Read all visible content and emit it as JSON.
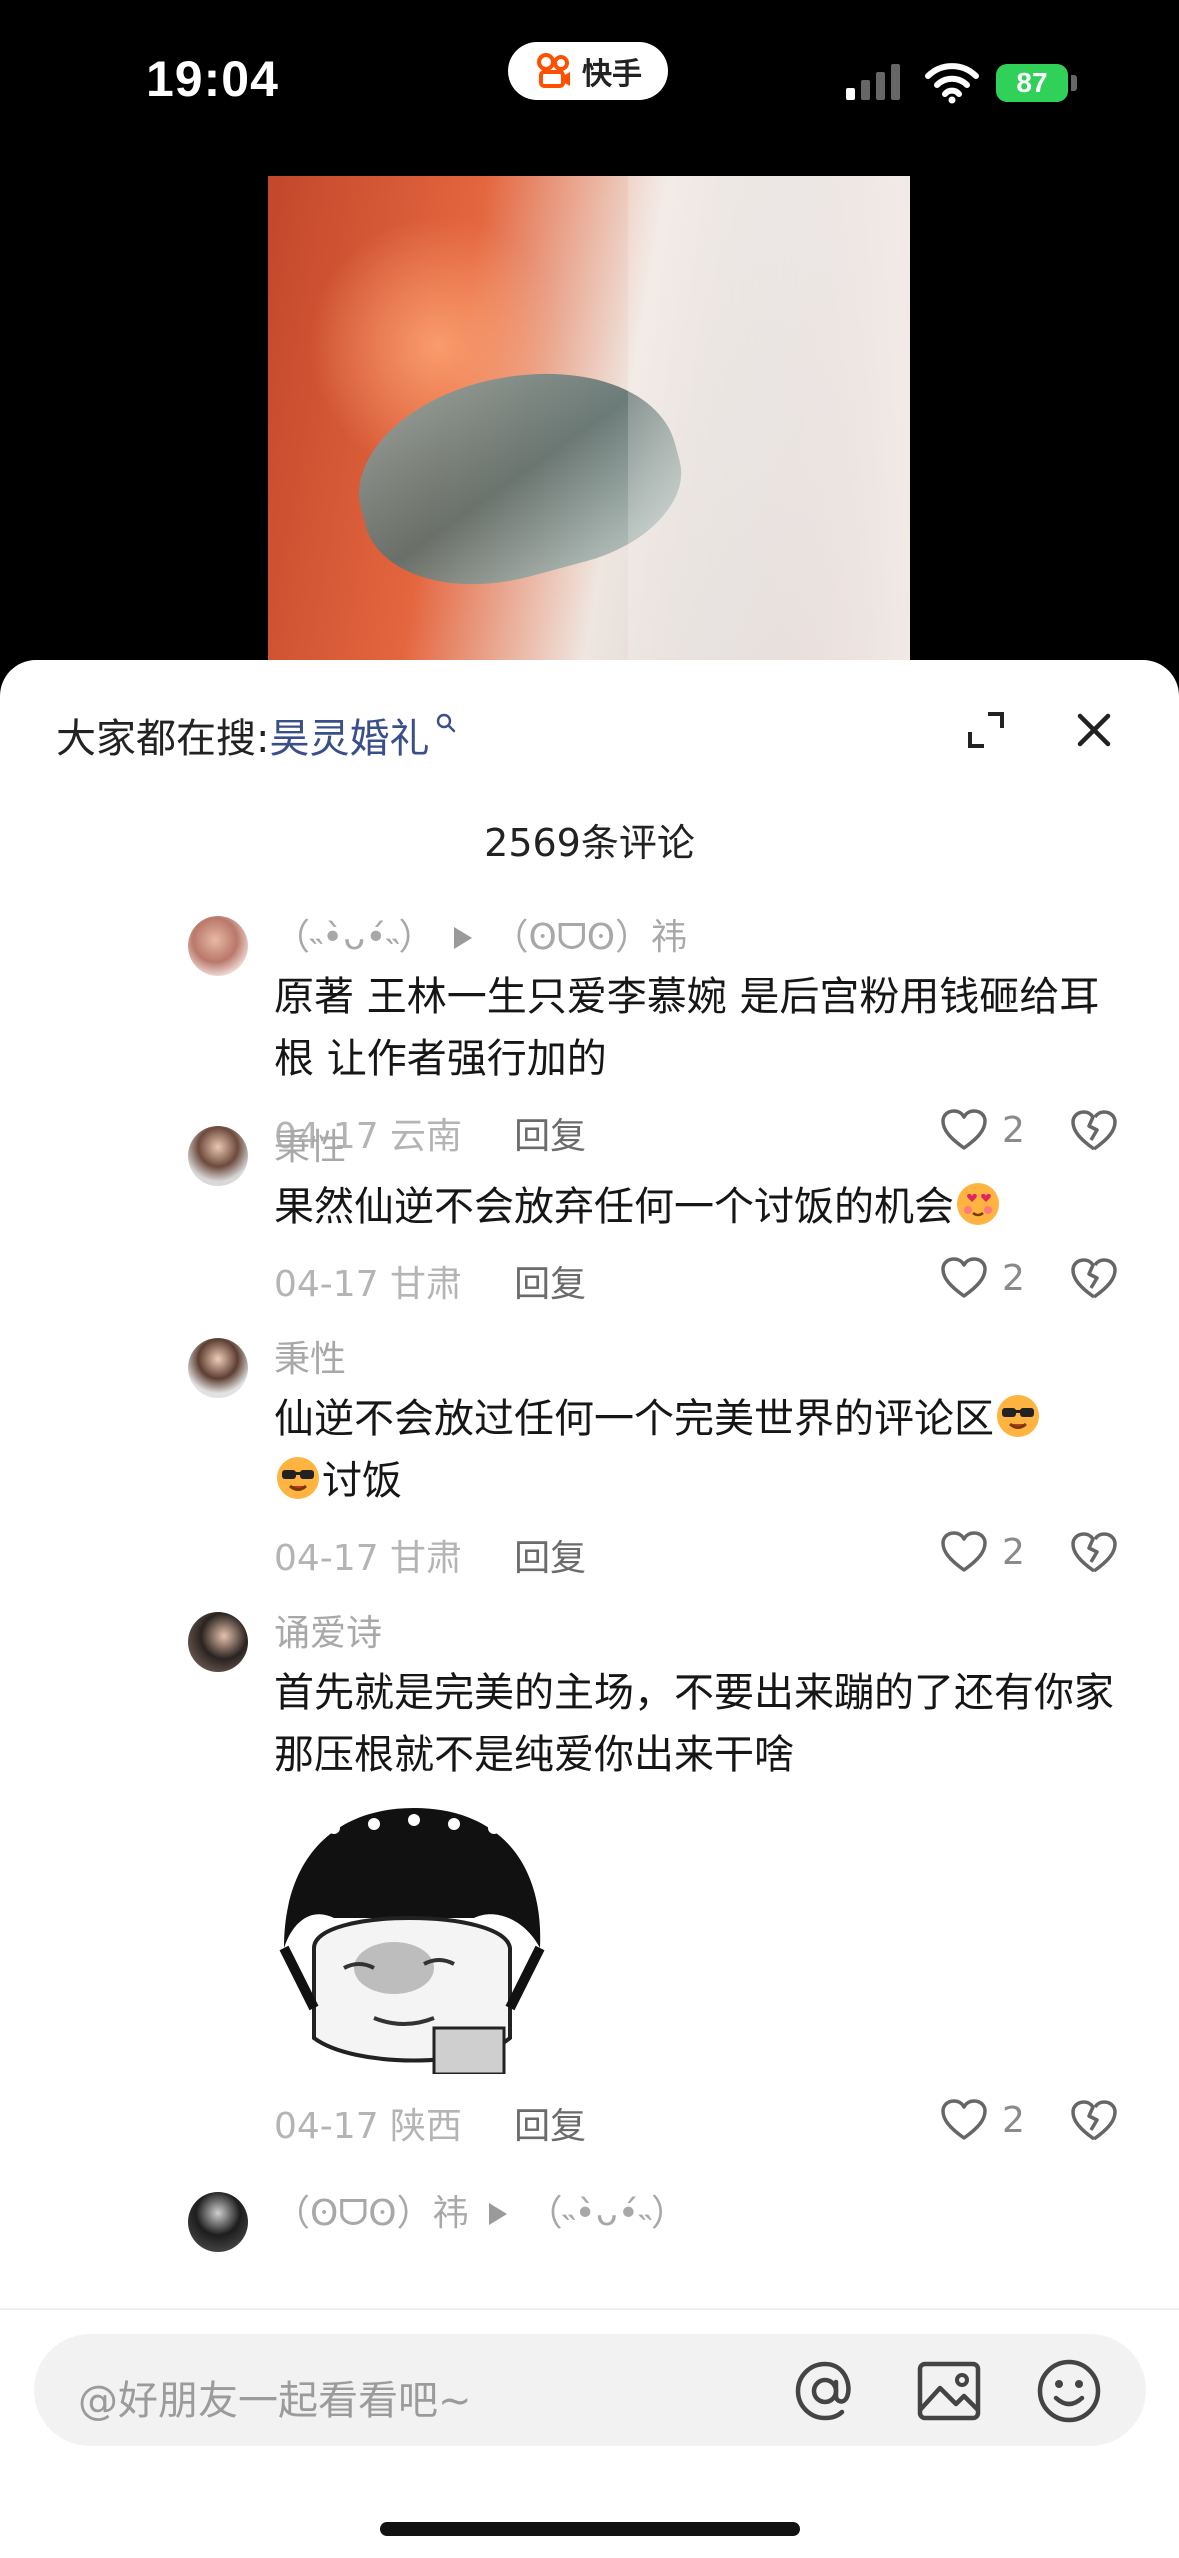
{
  "status_bar": {
    "time": "19:04",
    "app_name": "快手",
    "battery": "87"
  },
  "sheet": {
    "search_prefix": "大家都在搜:",
    "search_term": "昊灵婚礼",
    "comment_count": "2569条评论"
  },
  "comments": [
    {
      "user": "（˵•̀ᴗ•́˵）",
      "reply_to": "（ʘᗜʘ）祎",
      "text": "原著 王林一生只爱李慕婉 是后宫粉用钱砸给耳根 让作者强行加的",
      "date": "04-17 云南",
      "reply_label": "回复",
      "likes": "2"
    },
    {
      "user": "秉性",
      "text": "果然仙逆不会放弃任何一个讨饭的机会",
      "date": "04-17 甘肃",
      "reply_label": "回复",
      "likes": "2",
      "emoji": "heart-eyes-face"
    },
    {
      "user": "秉性",
      "text_a": "仙逆不会放过任何一个完美世界的评论区",
      "text_b": "讨饭",
      "date": "04-17 甘肃",
      "reply_label": "回复",
      "likes": "2",
      "emoji": "sunglasses-face"
    },
    {
      "user": "诵爱诗",
      "text": "首先就是完美的主场，不要出来蹦的了还有你家那压根就不是纯爱你出来干啥",
      "date": "04-17 陕西",
      "reply_label": "回复",
      "likes": "2",
      "sticker": "meme-sticker"
    },
    {
      "user": "（ʘᗜʘ）祎",
      "reply_to": "（˵•̀ᴗ•́˵）"
    }
  ],
  "input": {
    "placeholder": "@好朋友一起看看吧~"
  },
  "colors": {
    "accent_search": "#3a4f8a",
    "battery": "#30d158"
  }
}
